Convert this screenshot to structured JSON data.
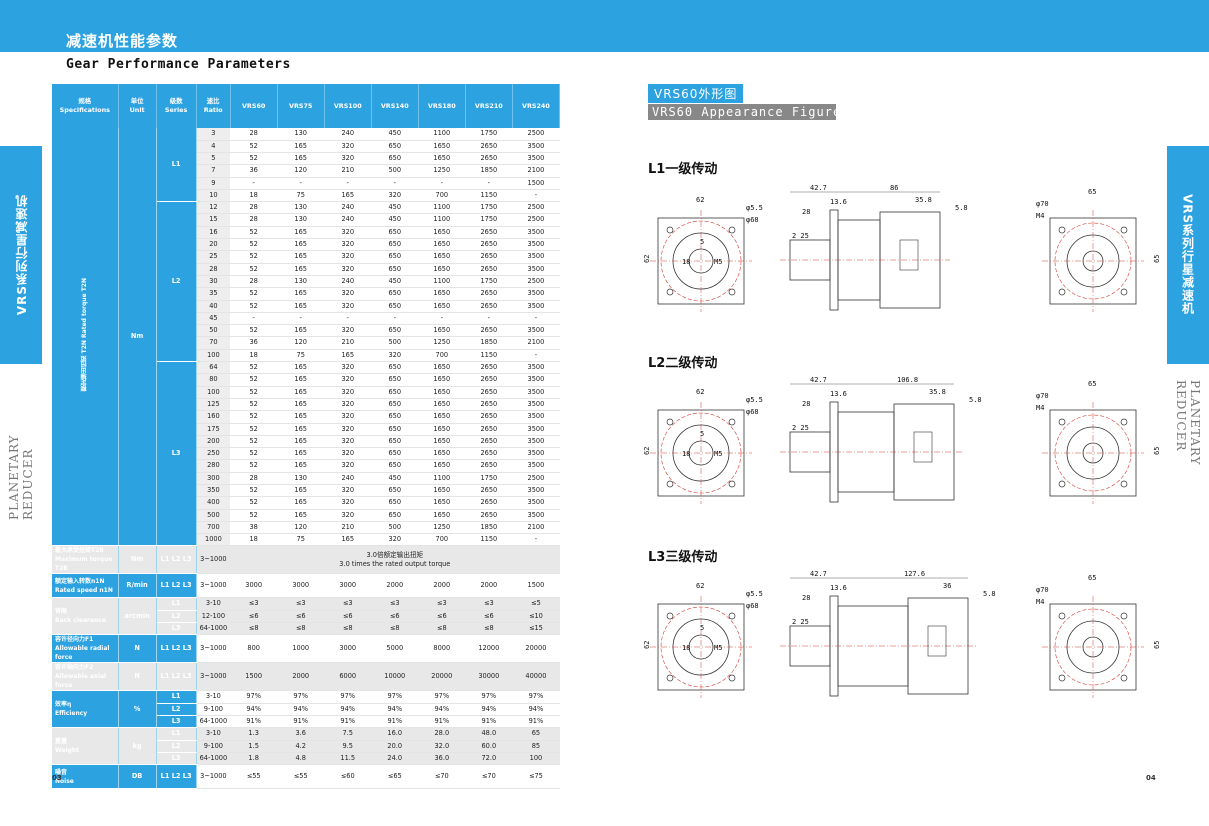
{
  "header": {
    "cn_title": "减速机性能参数",
    "en_title": "Gear Performance Parameters"
  },
  "side_left": {
    "tab": "VRS系列行星减速机",
    "text": "PLANETARY REDUCER"
  },
  "side_right": {
    "tab": "VRS系列行星减速机",
    "text": "PLANETARY REDUCER"
  },
  "table": {
    "headers": [
      {
        "cn": "规格",
        "en": "Specifications"
      },
      {
        "cn": "单位",
        "en": "Unit"
      },
      {
        "cn": "级数",
        "en": "Series"
      },
      {
        "cn": "速比",
        "en": "Ratio"
      },
      {
        "cn": "",
        "en": "VRS60"
      },
      {
        "cn": "",
        "en": "VRS75"
      },
      {
        "cn": "",
        "en": "VRS100"
      },
      {
        "cn": "",
        "en": "VRS140"
      },
      {
        "cn": "",
        "en": "VRS180"
      },
      {
        "cn": "",
        "en": "VRS210"
      },
      {
        "cn": "",
        "en": "VRS240"
      }
    ],
    "torque_label": "额定输出扭矩 T2N Rated torque T2N",
    "torque_unit": "Nm",
    "torque_groups": [
      {
        "series": "L1",
        "rows": [
          [
            "3",
            "28",
            "130",
            "240",
            "450",
            "1100",
            "1750",
            "2500"
          ],
          [
            "4",
            "52",
            "165",
            "320",
            "650",
            "1650",
            "2650",
            "3500"
          ],
          [
            "5",
            "52",
            "165",
            "320",
            "650",
            "1650",
            "2650",
            "3500"
          ],
          [
            "7",
            "36",
            "120",
            "210",
            "500",
            "1250",
            "1850",
            "2100"
          ],
          [
            "9",
            "-",
            "-",
            "-",
            "-",
            "-",
            "-",
            "1500"
          ],
          [
            "10",
            "18",
            "75",
            "165",
            "320",
            "700",
            "1150",
            "-"
          ]
        ]
      },
      {
        "series": "L2",
        "rows": [
          [
            "12",
            "28",
            "130",
            "240",
            "450",
            "1100",
            "1750",
            "2500"
          ],
          [
            "15",
            "28",
            "130",
            "240",
            "450",
            "1100",
            "1750",
            "2500"
          ],
          [
            "16",
            "52",
            "165",
            "320",
            "650",
            "1650",
            "2650",
            "3500"
          ],
          [
            "20",
            "52",
            "165",
            "320",
            "650",
            "1650",
            "2650",
            "3500"
          ],
          [
            "25",
            "52",
            "165",
            "320",
            "650",
            "1650",
            "2650",
            "3500"
          ],
          [
            "28",
            "52",
            "165",
            "320",
            "650",
            "1650",
            "2650",
            "3500"
          ],
          [
            "30",
            "28",
            "130",
            "240",
            "450",
            "1100",
            "1750",
            "2500"
          ],
          [
            "35",
            "52",
            "165",
            "320",
            "650",
            "1650",
            "2650",
            "3500"
          ],
          [
            "40",
            "52",
            "165",
            "320",
            "650",
            "1650",
            "2650",
            "3500"
          ],
          [
            "45",
            "-",
            "-",
            "-",
            "-",
            "-",
            "-",
            "-"
          ],
          [
            "50",
            "52",
            "165",
            "320",
            "650",
            "1650",
            "2650",
            "3500"
          ],
          [
            "70",
            "36",
            "120",
            "210",
            "500",
            "1250",
            "1850",
            "2100"
          ],
          [
            "100",
            "18",
            "75",
            "165",
            "320",
            "700",
            "1150",
            "-"
          ]
        ]
      },
      {
        "series": "L3",
        "rows": [
          [
            "64",
            "52",
            "165",
            "320",
            "650",
            "1650",
            "2650",
            "3500"
          ],
          [
            "80",
            "52",
            "165",
            "320",
            "650",
            "1650",
            "2650",
            "3500"
          ],
          [
            "100",
            "52",
            "165",
            "320",
            "650",
            "1650",
            "2650",
            "3500"
          ],
          [
            "125",
            "52",
            "165",
            "320",
            "650",
            "1650",
            "2650",
            "3500"
          ],
          [
            "160",
            "52",
            "165",
            "320",
            "650",
            "1650",
            "2650",
            "3500"
          ],
          [
            "175",
            "52",
            "165",
            "320",
            "650",
            "1650",
            "2650",
            "3500"
          ],
          [
            "200",
            "52",
            "165",
            "320",
            "650",
            "1650",
            "2650",
            "3500"
          ],
          [
            "250",
            "52",
            "165",
            "320",
            "650",
            "1650",
            "2650",
            "3500"
          ],
          [
            "280",
            "52",
            "165",
            "320",
            "650",
            "1650",
            "2650",
            "3500"
          ],
          [
            "300",
            "28",
            "130",
            "240",
            "450",
            "1100",
            "1750",
            "2500"
          ],
          [
            "350",
            "52",
            "165",
            "320",
            "650",
            "1650",
            "2650",
            "3500"
          ],
          [
            "400",
            "52",
            "165",
            "320",
            "650",
            "1650",
            "2650",
            "3500"
          ],
          [
            "500",
            "52",
            "165",
            "320",
            "650",
            "1650",
            "2650",
            "3500"
          ],
          [
            "700",
            "38",
            "120",
            "210",
            "500",
            "1250",
            "1850",
            "2100"
          ],
          [
            "1000",
            "18",
            "75",
            "165",
            "320",
            "700",
            "1150",
            "-"
          ]
        ]
      }
    ],
    "max_torque": {
      "label_cn": "最大承受扭矩T2B",
      "label_en": "Maximum torque T2B",
      "unit": "Nm",
      "series": "L1 L2 L3",
      "ratio": "3~1000",
      "value_cn": "3.0倍额定输出扭矩",
      "value_en": "3.0 times the rated output torque"
    },
    "rated_speed": {
      "label_cn": "额定输入转数n1N",
      "label_en": "Rated speed n1N",
      "unit": "R/min",
      "series": "L1 L2 L3",
      "ratio": "3~1000",
      "values": [
        "3000",
        "3000",
        "3000",
        "2000",
        "2000",
        "2000",
        "1500"
      ]
    },
    "backlash": {
      "label_cn": "背隙",
      "label_en": "Back clearance",
      "unit": "arcmin",
      "rows": [
        {
          "series": "L1",
          "ratio": "3-10",
          "values": [
            "≤3",
            "≤3",
            "≤3",
            "≤3",
            "≤3",
            "≤3",
            "≤5"
          ]
        },
        {
          "series": "L2",
          "ratio": "12-100",
          "values": [
            "≤6",
            "≤6",
            "≤6",
            "≤6",
            "≤6",
            "≤6",
            "≤10"
          ]
        },
        {
          "series": "L3",
          "ratio": "64-1000",
          "values": [
            "≤8",
            "≤8",
            "≤8",
            "≤8",
            "≤8",
            "≤8",
            "≤15"
          ]
        }
      ]
    },
    "radial_force": {
      "label_cn": "容许径向力F1",
      "label_en": "Allowable radial force",
      "unit": "N",
      "series": "L1 L2 L3",
      "ratio": "3~1000",
      "values": [
        "800",
        "1000",
        "3000",
        "5000",
        "8000",
        "12000",
        "20000"
      ]
    },
    "axial_force": {
      "label_cn": "容许轴向力F2",
      "label_en": "Allowable axial force",
      "unit": "N",
      "series": "L1 L2 L3",
      "ratio": "3~1000",
      "values": [
        "1500",
        "2000",
        "6000",
        "10000",
        "20000",
        "30000",
        "40000"
      ]
    },
    "efficiency": {
      "label_cn": "效率η",
      "label_en": "Efficiency",
      "unit": "%",
      "rows": [
        {
          "series": "L1",
          "ratio": "3-10",
          "values": [
            "97%",
            "97%",
            "97%",
            "97%",
            "97%",
            "97%",
            "97%"
          ]
        },
        {
          "series": "L2",
          "ratio": "9-100",
          "values": [
            "94%",
            "94%",
            "94%",
            "94%",
            "94%",
            "94%",
            "94%"
          ]
        },
        {
          "series": "L3",
          "ratio": "64-1000",
          "values": [
            "91%",
            "91%",
            "91%",
            "91%",
            "91%",
            "91%",
            "91%"
          ]
        }
      ]
    },
    "weight": {
      "label_cn": "重量",
      "label_en": "Weight",
      "unit": "kg",
      "rows": [
        {
          "series": "L1",
          "ratio": "3-10",
          "values": [
            "1.3",
            "3.6",
            "7.5",
            "16.0",
            "28.0",
            "48.0",
            "65"
          ]
        },
        {
          "series": "L2",
          "ratio": "9-100",
          "values": [
            "1.5",
            "4.2",
            "9.5",
            "20.0",
            "32.0",
            "60.0",
            "85"
          ]
        },
        {
          "series": "L3",
          "ratio": "64-1000",
          "values": [
            "1.8",
            "4.8",
            "11.5",
            "24.0",
            "36.0",
            "72.0",
            "100"
          ]
        }
      ]
    },
    "noise": {
      "label_cn": "噪音",
      "label_en": "Noise",
      "unit": "DB",
      "series": "L1 L2 L3",
      "ratio": "3~1000",
      "values": [
        "≤55",
        "≤55",
        "≤60",
        "≤65",
        "≤70",
        "≤70",
        "≤75"
      ]
    }
  },
  "figure": {
    "title": "VRS60外形图",
    "subtitle": "VRS60 Appearance Figure",
    "stages": [
      {
        "label": "L1一级传动",
        "total": "86",
        "out": "35.8"
      },
      {
        "label": "L2二级传动",
        "total": "106.8",
        "out": "35.8"
      },
      {
        "label": "L3三级传动",
        "total": "127.6",
        "out": "36"
      }
    ],
    "dims": {
      "d62": "62",
      "d42": "42.7",
      "d13": "13.6",
      "d28": "28",
      "d58": "5.8",
      "d2": "2",
      "d25": "25",
      "p55": "φ5.5",
      "p68": "φ68",
      "m5": "M5",
      "p18": "18",
      "n5": "5",
      "p65": "65",
      "p70": "φ70",
      "m4": "M4"
    }
  },
  "page_numbers": {
    "left": "03",
    "right": "04"
  },
  "colors": {
    "accent": "#2da2e0",
    "red_line": "#d23a2e"
  }
}
